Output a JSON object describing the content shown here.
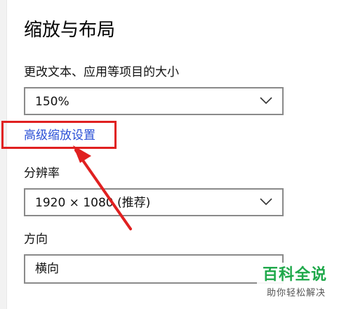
{
  "section": {
    "title": "缩放与布局"
  },
  "scale": {
    "label": "更改文本、应用等项目的大小",
    "selected": "150%"
  },
  "advanced_scaling_link": "高级缩放设置",
  "resolution": {
    "label": "分辨率",
    "selected": "1920 × 1080 (推荐)"
  },
  "orientation": {
    "label": "方向",
    "selected": "横向"
  },
  "watermark": {
    "title": "百科全说",
    "subtitle": "助你轻松解决"
  },
  "colors": {
    "link": "#2a4fd6",
    "annotation": "#e02020",
    "watermark": "#1ea84a"
  }
}
